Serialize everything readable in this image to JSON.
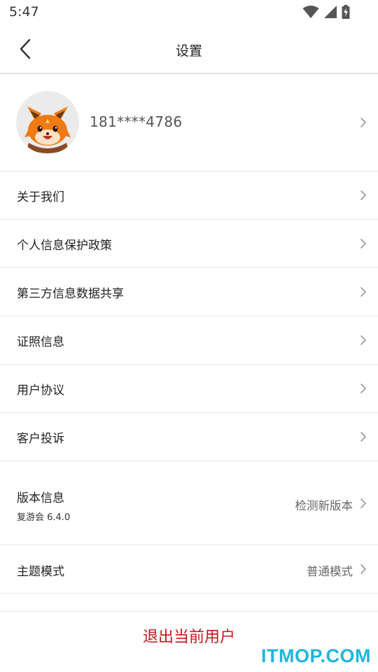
{
  "status_bar": {
    "time": "5:47",
    "icons": [
      "wifi-icon",
      "signal-icon",
      "battery-charging-icon"
    ]
  },
  "header": {
    "title": "设置",
    "back_icon": "chevron-left-icon"
  },
  "profile": {
    "avatar_icon": "fox-avatar-icon",
    "phone": "181****4786"
  },
  "menu": {
    "about_label": "关于我们",
    "privacy_label": "个人信息保护政策",
    "third_party_label": "第三方信息数据共享",
    "license_label": "证照信息",
    "agreement_label": "用户协议",
    "complaint_label": "客户投诉",
    "version_label": "版本信息",
    "version_sub": "复游会 6.4.0",
    "version_action": "检测新版本",
    "theme_label": "主题模式",
    "theme_value": "普通模式"
  },
  "footer": {
    "logout_label": "退出当前用户",
    "watermark": "ITMOP.COM"
  },
  "colors": {
    "accent": "#c6161d",
    "divider": "#e6e6e6",
    "watermark": "#1fb6dc"
  }
}
